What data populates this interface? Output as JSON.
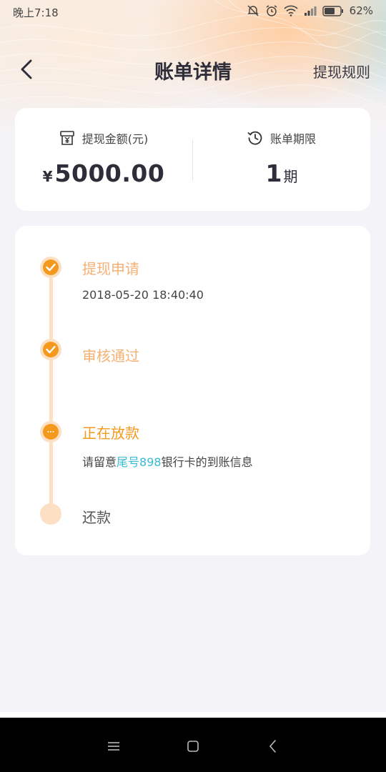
{
  "status_bar": {
    "time": "晚上7:18",
    "battery": "62%",
    "icons": [
      "do-not-disturb-icon",
      "alarm-icon",
      "wifi-icon",
      "signal-icon",
      "battery-icon"
    ]
  },
  "nav": {
    "title": "账单详情",
    "right_link": "提现规则"
  },
  "summary": {
    "amount_label": "提现金额(元)",
    "amount_currency": "¥",
    "amount_value": "5000.00",
    "period_label": "账单期限",
    "period_value": "1",
    "period_unit": "期"
  },
  "timeline": {
    "steps": [
      {
        "title": "提现申请",
        "subtitle": "2018-05-20 18:40:40",
        "state": "done"
      },
      {
        "title": "审核通过",
        "subtitle": "",
        "state": "done"
      },
      {
        "title": "正在放款",
        "state": "active",
        "subtitle_prefix": "请留意",
        "subtitle_highlight": "尾号898",
        "subtitle_suffix": "银行卡的到账信息"
      },
      {
        "title": "还款",
        "subtitle": "",
        "state": "pending"
      }
    ]
  },
  "colors": {
    "accent_orange": "#f39a1e",
    "done_orange": "#f5b073",
    "line_light": "#fde0c4",
    "link_teal": "#3bbad3"
  }
}
